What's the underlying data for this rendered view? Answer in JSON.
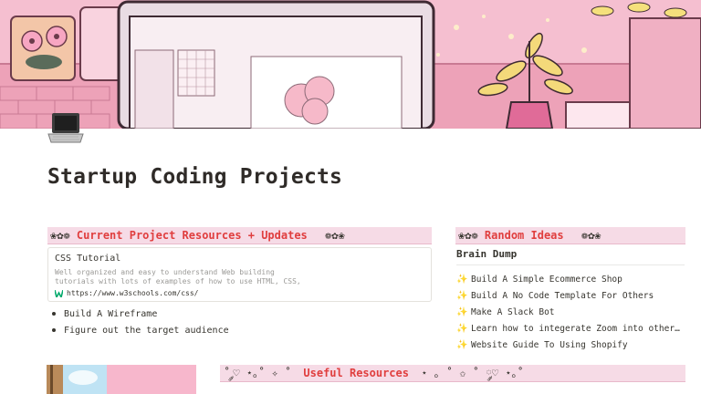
{
  "cover": {
    "alt": "pixel art desk with laptop and plant"
  },
  "page": {
    "icon": "laptop-icon",
    "title": "Startup Coding Projects"
  },
  "project_resources": {
    "deco_left": "❀✿❁",
    "title": "Current Project Resources + Updates",
    "deco_right": "❁✿❀",
    "bookmark": {
      "title": "CSS Tutorial",
      "description_line1": "Well organized and easy to understand Web building",
      "description_line2": "tutorials with lots of examples of how to use HTML, CSS,",
      "url": "https://www.w3schools.com/css/",
      "favicon": "w3schools-icon"
    },
    "bullets": [
      "Build A Wireframe",
      "Figure out the target audience"
    ]
  },
  "random_ideas": {
    "deco_left": "❀✿❁",
    "title": "Random Ideas",
    "deco_right": "❁✿❀",
    "subtitle": "Brain Dump",
    "items": [
      "Build A Simple Ecommerce Shop",
      "Build A No Code Template For Others",
      "Make A Slack Bot",
      "Learn how to integerate Zoom into other t…",
      "Website Guide To Using Shopify"
    ],
    "item_icon": "sparkles-icon"
  },
  "useful_resources": {
    "deco_left": "˚ ༘♡ ⋆｡˚ ✧ ˚",
    "title": "Useful Resources",
    "deco_right": "⋆ ｡ ˚ ✩ ˚ ༘♡ ⋆｡˚"
  },
  "colors": {
    "header_bg": "#f6dbe6",
    "accent_red": "#e03e3e",
    "text": "#37352f",
    "muted": "#9b9a97"
  }
}
